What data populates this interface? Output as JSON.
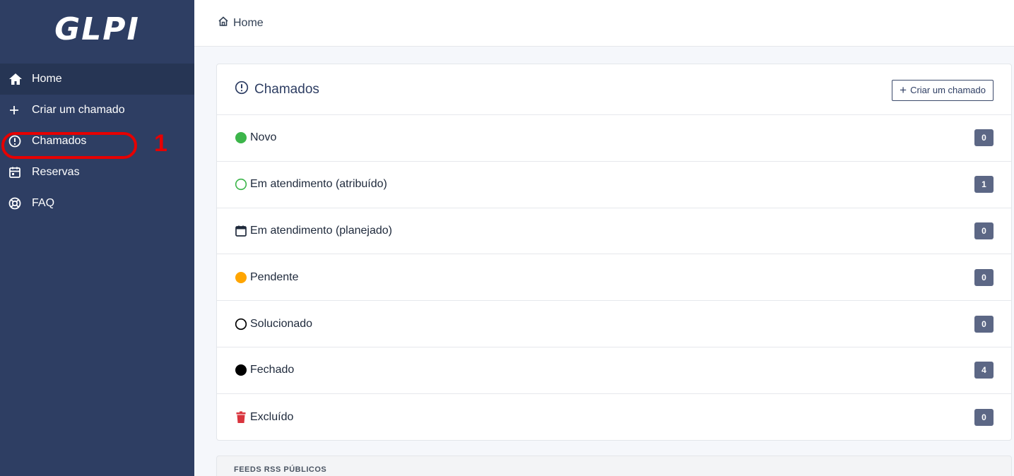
{
  "app": {
    "logo_text": "GLPI"
  },
  "sidebar": {
    "items": [
      {
        "label": "Home",
        "icon": "home-icon"
      },
      {
        "label": "Criar um chamado",
        "icon": "plus-icon"
      },
      {
        "label": "Chamados",
        "icon": "exclamation-circle-icon"
      },
      {
        "label": "Reservas",
        "icon": "calendar-icon"
      },
      {
        "label": "FAQ",
        "icon": "lifebuoy-icon"
      }
    ]
  },
  "annotation": {
    "number": "1",
    "color": "#e60000"
  },
  "header": {
    "breadcrumb": "Home"
  },
  "tickets_card": {
    "title": "Chamados",
    "new_button": "Criar um chamado",
    "statuses": [
      {
        "label": "Novo",
        "count": "0",
        "icon": "green-dot-icon",
        "color": "#3cb54a"
      },
      {
        "label": "Em atendimento (atribuído)",
        "count": "1",
        "icon": "green-circle-outline-icon",
        "color": "#3cb54a"
      },
      {
        "label": "Em atendimento (planejado)",
        "count": "0",
        "icon": "calendar-icon",
        "color": "#1e293b"
      },
      {
        "label": "Pendente",
        "count": "0",
        "icon": "orange-dot-icon",
        "color": "#ffa500"
      },
      {
        "label": "Solucionado",
        "count": "0",
        "icon": "black-circle-outline-icon",
        "color": "#000000"
      },
      {
        "label": "Fechado",
        "count": "4",
        "icon": "black-dot-icon",
        "color": "#000000"
      },
      {
        "label": "Excluído",
        "count": "0",
        "icon": "trash-icon",
        "color": "#d9343d"
      }
    ]
  },
  "rss": {
    "title": "FEEDS RSS PÚBLICOS"
  },
  "colors": {
    "sidebar_bg": "#2e3e63",
    "sidebar_active": "#263554",
    "badge_bg": "#5c6785"
  }
}
